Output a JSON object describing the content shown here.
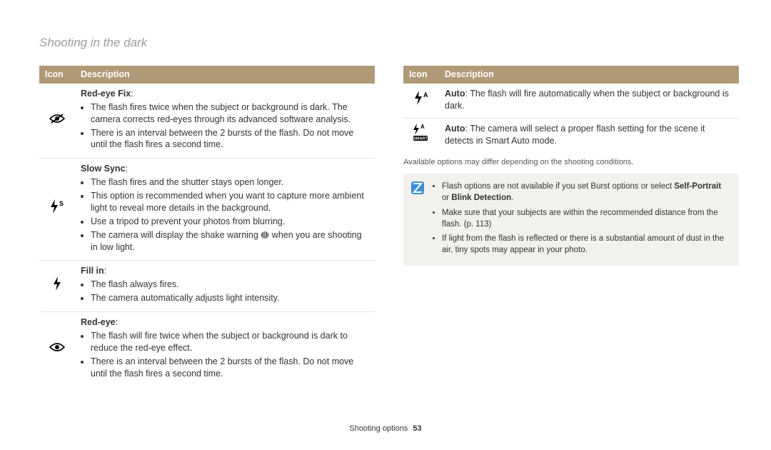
{
  "pageTitle": "Shooting in the dark",
  "headers": {
    "icon": "Icon",
    "description": "Description"
  },
  "leftRows": [
    {
      "iconName": "red-eye-fix-icon",
      "iconGlyph": "eye-strike",
      "title": "Red-eye Fix",
      "bullets": [
        "The flash fires twice when the subject or background is dark. The camera corrects red-eyes through its advanced software analysis.",
        "There is an interval between the 2 bursts of the flash. Do not move until the flash fires a second time."
      ]
    },
    {
      "iconName": "slow-sync-icon",
      "iconGlyph": "flash-s",
      "title": "Slow Sync",
      "bullets": [
        "The flash fires and the shutter stays open longer.",
        "This option is recommended when you want to capture more ambient light to reveal more details in the background.",
        "Use a tripod to prevent your photos from blurring.",
        "The camera will display the shake warning {{shake}} when you are shooting in low light."
      ]
    },
    {
      "iconName": "fill-in-icon",
      "iconGlyph": "flash",
      "title": "Fill in",
      "bullets": [
        "The flash always fires.",
        "The camera automatically adjusts light intensity."
      ]
    },
    {
      "iconName": "red-eye-icon",
      "iconGlyph": "eye",
      "title": "Red-eye",
      "bullets": [
        "The flash will fire twice when the subject or background is dark to reduce the red-eye effect.",
        "There is an interval between the 2 bursts of the flash. Do not move until the flash fires a second time."
      ]
    }
  ],
  "rightRows": [
    {
      "iconName": "auto-flash-icon",
      "iconGlyph": "flash-a",
      "boldLead": "Auto",
      "text": ": The flash will fire automatically when the subject or background is dark."
    },
    {
      "iconName": "smart-auto-flash-icon",
      "iconGlyph": "flash-a-smart",
      "boldLead": "Auto",
      "text": ": The camera will select a proper flash setting for the scene it detects in Smart Auto mode."
    }
  ],
  "availabilityNote": "Available options may differ depending on the shooting conditions.",
  "noteBox": {
    "bullets": [
      {
        "pre": "Flash options are not available if you set Burst options or select ",
        "bold1": "Self-Portrait",
        "mid": " or ",
        "bold2": "Blink Detection",
        "post": "."
      },
      {
        "text": "Make sure that your subjects are within the recommended distance from the flash. (p. 113)"
      },
      {
        "text": "If light from the flash is reflected or there is a substantial amount of dust in the air, tiny spots may appear in your photo."
      }
    ]
  },
  "footer": {
    "section": "Shooting options",
    "page": "53"
  }
}
